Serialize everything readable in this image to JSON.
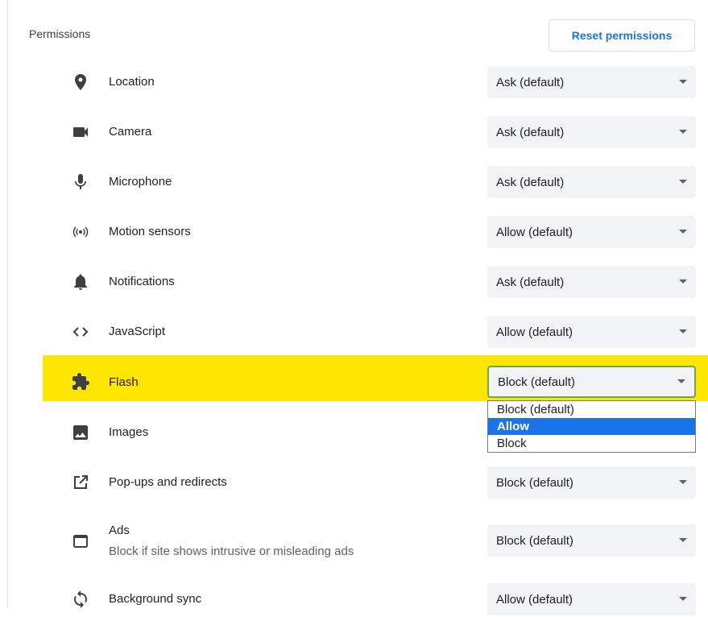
{
  "section": {
    "title": "Permissions",
    "reset_label": "Reset permissions"
  },
  "permissions": [
    {
      "label": "Location",
      "value": "Ask (default)",
      "icon": "location-pin-icon"
    },
    {
      "label": "Camera",
      "value": "Ask (default)",
      "icon": "camera-icon"
    },
    {
      "label": "Microphone",
      "value": "Ask (default)",
      "icon": "microphone-icon"
    },
    {
      "label": "Motion sensors",
      "value": "Allow (default)",
      "icon": "motion-sensors-icon"
    },
    {
      "label": "Notifications",
      "value": "Ask (default)",
      "icon": "bell-icon"
    },
    {
      "label": "JavaScript",
      "value": "Allow (default)",
      "icon": "code-icon"
    },
    {
      "label": "Flash",
      "value": "Block (default)",
      "icon": "puzzle-piece-icon"
    },
    {
      "label": "Images",
      "value": "",
      "icon": "image-icon"
    },
    {
      "label": "Pop-ups and redirects",
      "value": "Block (default)",
      "icon": "open-external-icon"
    },
    {
      "label": "Ads",
      "sublabel": "Block if site shows intrusive or misleading ads",
      "value": "Block (default)",
      "icon": "window-icon"
    },
    {
      "label": "Background sync",
      "value": "Allow (default)",
      "icon": "sync-icon"
    }
  ],
  "flash_dropdown": {
    "options": [
      "Block (default)",
      "Allow",
      "Block"
    ],
    "highlighted": "Allow"
  },
  "colors": {
    "highlight": "#ffe600",
    "accent": "#1a73e8",
    "select_bg": "#f1f3f4"
  }
}
